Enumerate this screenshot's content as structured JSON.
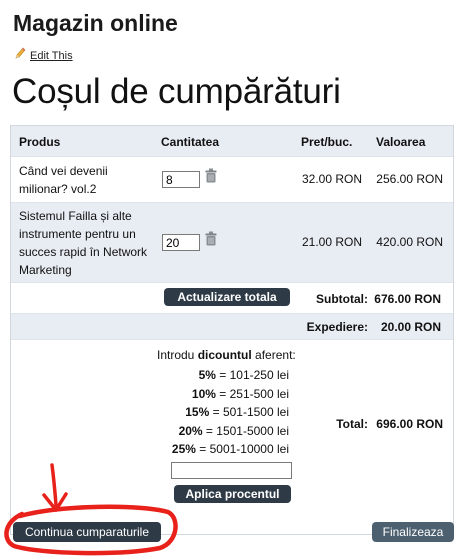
{
  "site": {
    "title": "Magazin online",
    "edit_link": "Edit This"
  },
  "page": {
    "title": "Coșul de cumpărături"
  },
  "cart": {
    "columns": {
      "product": "Produs",
      "quantity": "Cantitatea",
      "unit_price": "Pret/buc.",
      "value": "Valoarea"
    },
    "items": [
      {
        "product_lines": [
          "Când vei devenii",
          "milionar? vol.2"
        ],
        "quantity": "8",
        "unit_price": "32.00 RON",
        "value": "256.00 RON"
      },
      {
        "product_lines": [
          "Sistemul Failla și alte",
          "instrumente pentru un",
          "succes rapid în Network",
          "Marketing"
        ],
        "quantity": "20",
        "unit_price": "21.00 RON",
        "value": "420.00 RON"
      }
    ],
    "update_button": "Actualizare totala",
    "subtotal_label": "Subtotal:",
    "subtotal_value": "676.00 RON",
    "shipping_label": "Expediere:",
    "shipping_value": "20.00 RON",
    "discount": {
      "intro_prefix": "Introdu ",
      "intro_bold": "dicountul",
      "intro_suffix": " aferent:",
      "tiers": [
        {
          "pct": "5%",
          "range": " = 101-250 lei"
        },
        {
          "pct": "10%",
          "range": " = 251-500 lei"
        },
        {
          "pct": "15%",
          "range": " = 501-1500 lei"
        },
        {
          "pct": "20%",
          "range": " = 1501-5000 lei"
        },
        {
          "pct": "25%",
          "range": " = 5001-10000 lei"
        }
      ],
      "coupon_value": "",
      "apply_button": "Aplica procentul"
    },
    "total_label": "Total:",
    "total_value": "696.00 RON"
  },
  "actions": {
    "continue_button": "Continua cumparaturile",
    "finish_button": "Finalizeaza"
  },
  "icons": {
    "edit": "pencil-icon",
    "delete": "trash-icon"
  },
  "colors": {
    "button": "#2e3b47",
    "header_bg": "#e8ecf3",
    "annotation": "#e8211b"
  }
}
